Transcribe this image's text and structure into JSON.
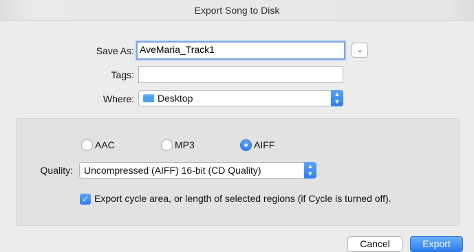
{
  "window": {
    "title": "Export Song to Disk"
  },
  "fields": {
    "save_as_label": "Save As:",
    "save_as_value": "AveMaria_Track1",
    "tags_label": "Tags:",
    "tags_value": "",
    "where_label": "Where:",
    "where_value": "Desktop",
    "expand_icon": "chevron-down-icon",
    "folder_icon": "folder-icon"
  },
  "format": {
    "options": [
      {
        "label": "AAC",
        "selected": false
      },
      {
        "label": "MP3",
        "selected": false
      },
      {
        "label": "AIFF",
        "selected": true
      }
    ],
    "quality_label": "Quality:",
    "quality_value": "Uncompressed (AIFF) 16-bit (CD Quality)",
    "cycle_checkbox_checked": true,
    "cycle_checkbox_label": "Export cycle area, or length of selected regions (if Cycle is turned off)."
  },
  "buttons": {
    "cancel": "Cancel",
    "export": "Export"
  },
  "colors": {
    "accent": "#3b86f2",
    "background": "#ececec",
    "group_box": "#e2e2e2"
  }
}
